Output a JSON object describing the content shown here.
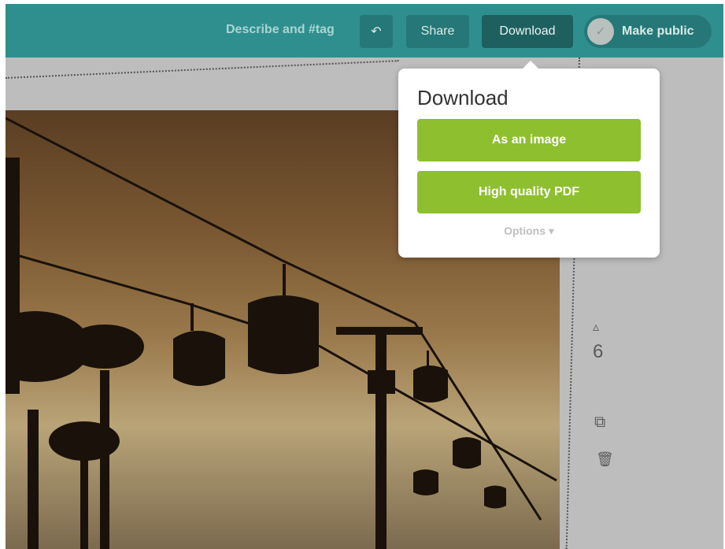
{
  "toolbar": {
    "describe_label": "Describe and #tag",
    "undo_icon": "↶",
    "share_label": "Share",
    "download_label": "Download",
    "make_public_label": "Make public",
    "toggle_icon": "✓"
  },
  "download_menu": {
    "title": "Download",
    "as_image_label": "As an image",
    "pdf_label": "High quality PDF",
    "options_label": "Options ▾"
  },
  "side_panel": {
    "up_icon": "▵",
    "page_number": "6",
    "copy_icon": "⧉",
    "trash_icon": "🗑"
  },
  "colors": {
    "toolbar": "#2f8f8f",
    "download_active": "#1e5f60",
    "green_button": "#8dbf2f"
  }
}
